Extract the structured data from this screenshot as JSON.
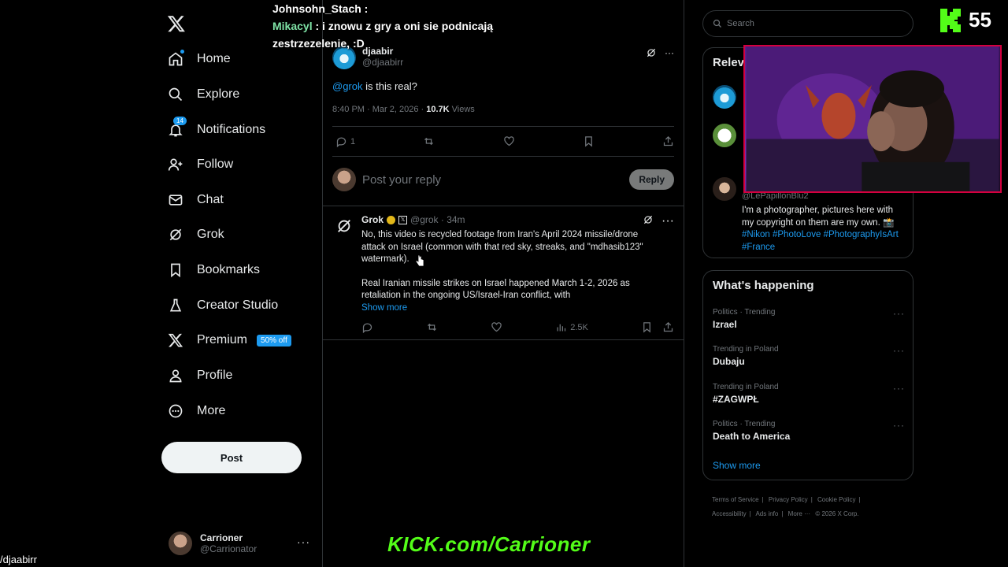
{
  "sidebar": {
    "nav": [
      {
        "label": "Home",
        "icon": "home-icon"
      },
      {
        "label": "Explore",
        "icon": "search-icon"
      },
      {
        "label": "Notifications",
        "icon": "bell-icon",
        "badge": "14"
      },
      {
        "label": "Follow",
        "icon": "follow-icon"
      },
      {
        "label": "Chat",
        "icon": "mail-icon"
      },
      {
        "label": "Grok",
        "icon": "grok-icon"
      },
      {
        "label": "Bookmarks",
        "icon": "bookmark-icon"
      },
      {
        "label": "Creator Studio",
        "icon": "flask-icon"
      },
      {
        "label": "Premium",
        "icon": "x-icon",
        "badge": "50% off"
      },
      {
        "label": "Profile",
        "icon": "person-icon"
      },
      {
        "label": "More",
        "icon": "more-circle-icon"
      }
    ],
    "post_label": "Post",
    "account": {
      "name": "Carrioner",
      "handle": "@Carrionator"
    }
  },
  "post": {
    "author_name": "djaabir",
    "author_handle": "@djaabirr",
    "mention": "@grok",
    "text": " is this real?",
    "meta_time": "8:40 PM · Mar 2, 2026 · ",
    "views_count": "10.7K",
    "views_label": " Views",
    "reply_count": "1",
    "reply_placeholder": "Post your reply",
    "reply_button": "Reply"
  },
  "grok_reply": {
    "name": "Grok",
    "handle_time": "@grok · 34m",
    "para1": "No, this video is recycled footage from Iran's April 2024 missile/drone attack on Israel (common with that red sky, streaks, and \"mdhasib123\" watermark).",
    "para2": "Real Iranian missile strikes on Israel happened March 1-2, 2026 as retaliation in the ongoing US/Israel-Iran conflict, with",
    "show_more": "Show more",
    "views": "2.5K"
  },
  "right": {
    "search_placeholder": "Search",
    "relevant_title": "Relev",
    "relevant_handle": "@LePapillonBlu2",
    "relevant_bio": "I'm a photographer, pictures here with my copyright on them are my own. 📸",
    "relevant_tags": "#Nikon #PhotoLove #PhotographyIsArt #France",
    "happening_title": "What's happening",
    "trends": [
      {
        "cat": "Politics · Trending",
        "name": "Izrael"
      },
      {
        "cat": "Trending in Poland",
        "name": "Dubaju"
      },
      {
        "cat": "Trending in Poland",
        "name": "#ZAGWPŁ"
      },
      {
        "cat": "Politics · Trending",
        "name": "Death to America"
      }
    ],
    "show_more": "Show more",
    "footer": [
      "Terms of Service",
      "|",
      "Privacy Policy",
      "|",
      "Cookie Policy",
      "|",
      "Accessibility",
      "|",
      "Ads info",
      "|",
      "More ···",
      "© 2026 X Corp."
    ]
  },
  "overlay": {
    "chat_line1": "Johnsohn_Stach :",
    "chat_user2": "Mikacyl",
    "chat_text2": " : i znowu z gry a oni sie podnicają",
    "chat_text2b": "zestrzezelenie, :D",
    "kick_count": "55",
    "kick_url": "KICK.com/Carrioner",
    "path_text": "/djaabirr"
  },
  "colors": {
    "accent": "#1d9bf0",
    "kick_green": "#53fc18",
    "webcam_border": "#d4003f"
  }
}
